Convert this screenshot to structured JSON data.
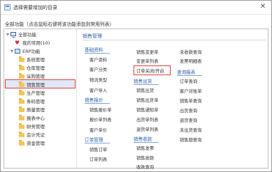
{
  "title": "选择需要增加的目录",
  "hint": "全部功能（点击鼠标右键将该功能添加到常用列表）",
  "tree": {
    "root": "全部功能",
    "favorites": "我的常用(10)",
    "erp": "ERP功能",
    "modules": [
      "系统管理",
      "仓库管理",
      "采购管理",
      "销售管理",
      "生产管理",
      "条码管理",
      "质量管理",
      "报表中心",
      "财务管理",
      "会计凭证",
      "资金管理"
    ],
    "selected": "销售管理"
  },
  "content": {
    "section": "销售管理",
    "groups": [
      {
        "title": "基础资料",
        "items": [
          "客户资料",
          "客户分类",
          "物流类型",
          "客户导入"
        ]
      },
      {
        "title": "销售报价",
        "items": [
          "销售报价单",
          "报价单列表",
          "客户单价"
        ]
      },
      {
        "title": "订单管理",
        "items": [
          "销售订单",
          "订单列表"
        ]
      },
      {
        "title": "",
        "items": [
          "销售变更单",
          "变更单列表",
          "订单关闭/开启"
        ]
      },
      {
        "title": "销售出货",
        "items": [
          "销售出货",
          "销售出货单",
          "销售通知单",
          "出货单列表",
          "退货单列表"
        ]
      },
      {
        "title": "销售收款",
        "items": [
          "销售发票",
          "销售收款",
          "收款查询"
        ]
      },
      {
        "title": "",
        "items": [
          "未收款查询",
          "发票明细表"
        ]
      },
      {
        "title": "查询报表",
        "items": [
          "订单查询",
          "客户对账单",
          "销售单查询",
          "出货查询",
          "退货查询",
          "未出货查询",
          "销售额查询"
        ]
      }
    ],
    "highlighted_item": "订单关闭/开启"
  }
}
